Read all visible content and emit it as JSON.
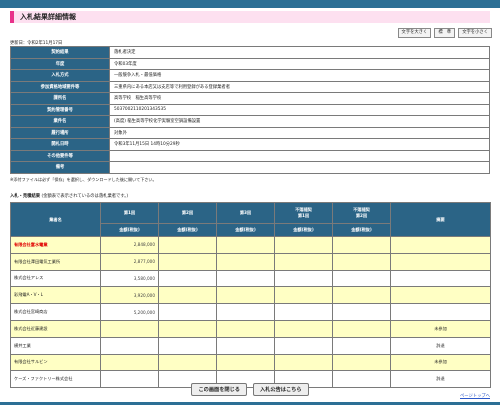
{
  "page": {
    "title": "入札結果詳細情報",
    "updated": "更新日：令和2年11月17日"
  },
  "size_buttons": [
    "文字を大きく",
    "標　準",
    "文字を小さく"
  ],
  "info_rows": [
    {
      "label": "契約結果",
      "value": "落札者決定"
    },
    {
      "label": "年度",
      "value": "令和03年度"
    },
    {
      "label": "入札方式",
      "value": "一般競争入札・最低価格"
    },
    {
      "label": "参加資格地域要件等",
      "value": "三重県内にある本店又は支店等で利用登録がある登録業者者"
    },
    {
      "label": "課所名",
      "value": "高等学校　稲生高等学校"
    },
    {
      "label": "契約管理番号",
      "value": "5037002110201343535"
    },
    {
      "label": "業件名",
      "value": "(高度) 稲生高等学校化学実験室空調設備設置"
    },
    {
      "label": "履行場所",
      "value": "対象外"
    },
    {
      "label": "開札日時",
      "value": "令和3年11月15日 14時10分29秒"
    },
    {
      "label": "その他要件等",
      "value": ""
    },
    {
      "label": "備考",
      "value": ""
    }
  ],
  "note": "※添付ファイルは必ず「保存」を選択し、ダウンロードした後に開いて下さい。",
  "section": {
    "title": "入札・見積結果",
    "note": "(金額表で表示されているのは落札業者です。)"
  },
  "results_header": {
    "name": "業者名",
    "round1": "第1回",
    "round2": "第2回",
    "round3": "第3回",
    "low1": "不落随契\n第1回",
    "low2": "不落随契\n第2回",
    "remarks": "摘要",
    "amount": "金額(税抜)"
  },
  "results": [
    {
      "name": "有限会社富水電業",
      "amount": "2,848,000",
      "remarks": "",
      "winner": true,
      "highlight": true
    },
    {
      "name": "有限会社澤田電気工業所",
      "amount": "2,877,000",
      "remarks": "",
      "winner": false,
      "highlight": true
    },
    {
      "name": "株式会社アレス",
      "amount": "3,580,000",
      "remarks": "",
      "winner": false,
      "highlight": false
    },
    {
      "name": "彩飛電A・V・L",
      "amount": "3,920,000",
      "remarks": "",
      "winner": false,
      "highlight": true
    },
    {
      "name": "株式会社宮崎商店",
      "amount": "5,200,000",
      "remarks": "",
      "winner": false,
      "highlight": false
    },
    {
      "name": "株式会社近藤建設",
      "amount": "",
      "remarks": "未参加",
      "winner": false,
      "highlight": true
    },
    {
      "name": "横井工業",
      "amount": "",
      "remarks": "辞退",
      "winner": false,
      "highlight": false
    },
    {
      "name": "有限会社サルビン",
      "amount": "",
      "remarks": "未参加",
      "winner": false,
      "highlight": true
    },
    {
      "name": "ケーズ・ファクトリー株式会社",
      "amount": "",
      "remarks": "辞退",
      "winner": false,
      "highlight": false
    }
  ],
  "buttons": {
    "close": "この画面を閉じる",
    "notice": "入札公告はこちら"
  },
  "page_top": "ページトップへ"
}
